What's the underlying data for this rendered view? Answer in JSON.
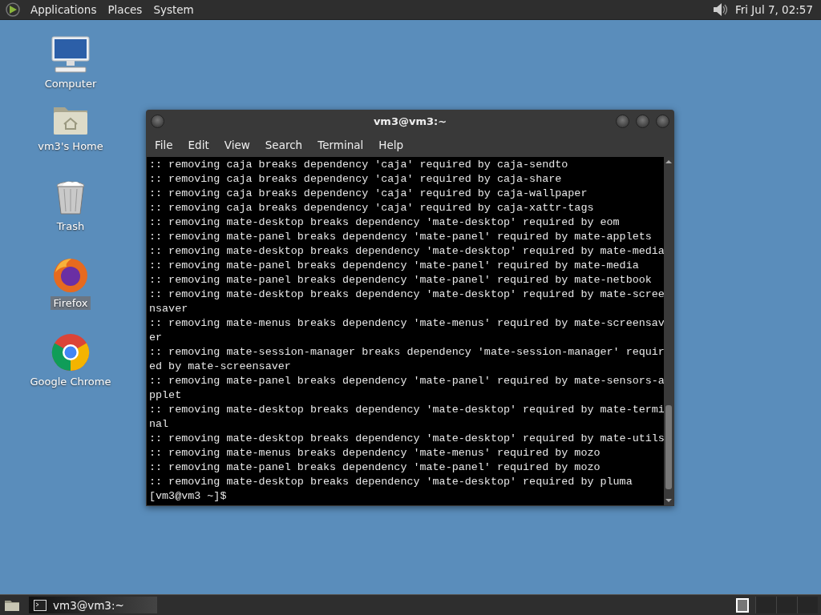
{
  "top_panel": {
    "menus": [
      "Applications",
      "Places",
      "System"
    ],
    "clock": "Fri Jul  7, 02:57"
  },
  "desktop_icons": [
    {
      "kind": "computer",
      "label": "Computer",
      "selected": false
    },
    {
      "kind": "home",
      "label": "vm3's Home",
      "selected": false
    },
    {
      "kind": "trash",
      "label": "Trash",
      "selected": false
    },
    {
      "kind": "firefox",
      "label": "Firefox",
      "selected": true
    },
    {
      "kind": "chrome",
      "label": "Google Chrome",
      "selected": false
    }
  ],
  "window": {
    "title": "vm3@vm3:~",
    "menu": [
      "File",
      "Edit",
      "View",
      "Search",
      "Terminal",
      "Help"
    ],
    "lines": [
      ":: removing caja breaks dependency 'caja' required by caja-sendto",
      ":: removing caja breaks dependency 'caja' required by caja-share",
      ":: removing caja breaks dependency 'caja' required by caja-wallpaper",
      ":: removing caja breaks dependency 'caja' required by caja-xattr-tags",
      ":: removing mate-desktop breaks dependency 'mate-desktop' required by eom",
      ":: removing mate-panel breaks dependency 'mate-panel' required by mate-applets",
      ":: removing mate-desktop breaks dependency 'mate-desktop' required by mate-media",
      ":: removing mate-panel breaks dependency 'mate-panel' required by mate-media",
      ":: removing mate-panel breaks dependency 'mate-panel' required by mate-netbook",
      ":: removing mate-desktop breaks dependency 'mate-desktop' required by mate-scree",
      "nsaver",
      ":: removing mate-menus breaks dependency 'mate-menus' required by mate-screensav",
      "er",
      ":: removing mate-session-manager breaks dependency 'mate-session-manager' requir",
      "ed by mate-screensaver",
      ":: removing mate-panel breaks dependency 'mate-panel' required by mate-sensors-a",
      "pplet",
      ":: removing mate-desktop breaks dependency 'mate-desktop' required by mate-termi",
      "nal",
      ":: removing mate-desktop breaks dependency 'mate-desktop' required by mate-utils",
      ":: removing mate-menus breaks dependency 'mate-menus' required by mozo",
      ":: removing mate-panel breaks dependency 'mate-panel' required by mozo",
      ":: removing mate-desktop breaks dependency 'mate-desktop' required by pluma",
      "[vm3@vm3 ~]$"
    ]
  },
  "taskbar": {
    "tasks": [
      {
        "label": "vm3@vm3:~",
        "selected": true
      }
    ]
  }
}
